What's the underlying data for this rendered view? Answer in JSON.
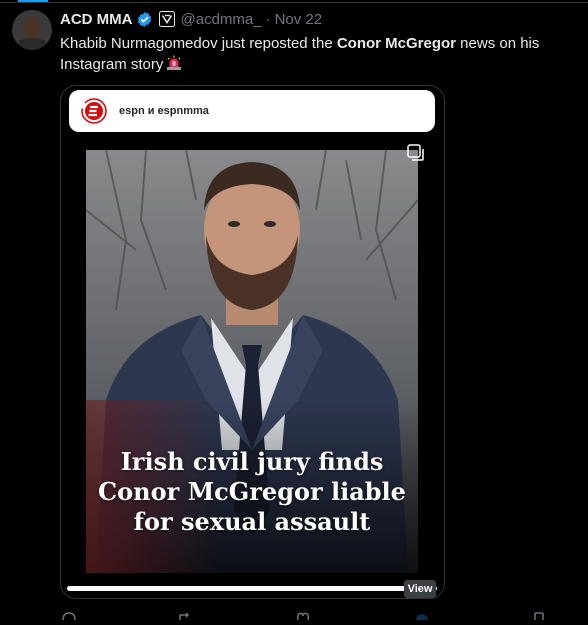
{
  "tweet": {
    "display_name": "ACD MMA",
    "handle": "@acdmma_",
    "separator": "·",
    "date": "Nov 22",
    "text_part1": "Khabib Nurmagomedov just reposted the ",
    "text_bold": "Conor McGregor",
    "text_part2": " news on his Instagram story"
  },
  "story": {
    "account_text": "espn и espnmma",
    "headline_line1": "Irish civil jury finds",
    "headline_line2": "Conor McGregor liable",
    "headline_line3": "for sexual assault"
  },
  "view_badge": "View",
  "icons": {
    "avatar": "avatar",
    "verified": "verified-badge-icon",
    "affiliation": "affiliation-badge-icon",
    "siren": "siren-emoji-icon",
    "espn": "espn-logo-icon",
    "multi_image": "multi-image-icon"
  },
  "colors": {
    "accent": "#1d9bf0",
    "secondary_text": "#71767b",
    "primary_text": "#e7e9ea",
    "background": "#000000"
  }
}
